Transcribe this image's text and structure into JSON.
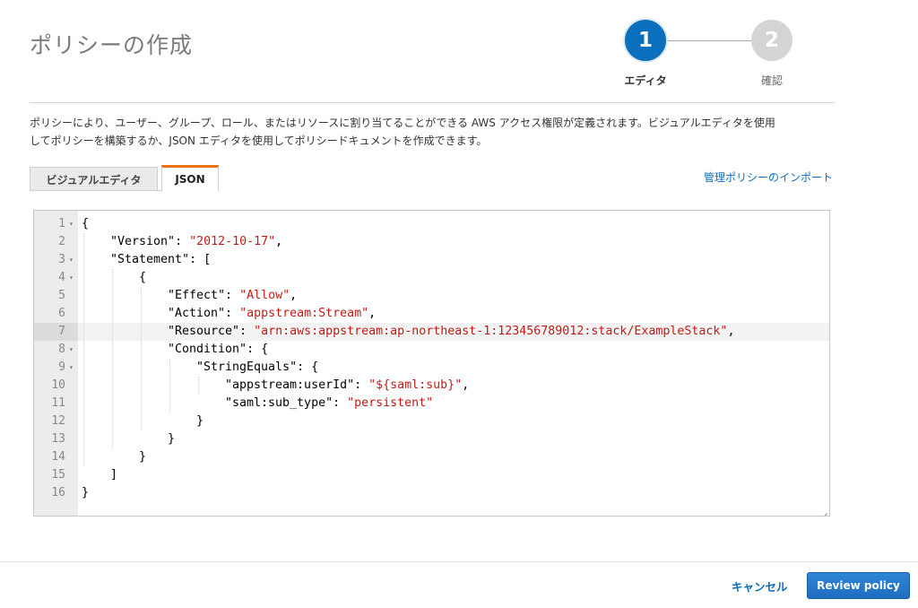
{
  "page": {
    "title": "ポリシーの作成"
  },
  "stepper": {
    "steps": [
      {
        "number": "1",
        "label": "エディタ",
        "state": "active"
      },
      {
        "number": "2",
        "label": "確認",
        "state": "inactive"
      }
    ],
    "active_color": "#0a6fbc",
    "inactive_color": "#d4d4d4"
  },
  "description": {
    "line1": "ポリシーにより、ユーザー、グループ、ロール、またはリソースに割り当てることができる AWS アクセス権限が定義されます。ビジュアルエディタを使用",
    "line2": "してポリシーを構築するか、JSON エディタを使用してポリシードキュメントを作成できます。"
  },
  "tabs": [
    {
      "label": "ビジュアルエディタ",
      "selected": false
    },
    {
      "label": "JSON",
      "selected": true
    }
  ],
  "import_link": "管理ポリシーのインポート",
  "editor": {
    "active_line": 7,
    "lines": [
      {
        "n": "1",
        "fold": true,
        "indent": 0,
        "parts": [
          [
            "p",
            "{"
          ]
        ]
      },
      {
        "n": "2",
        "fold": false,
        "indent": 1,
        "parts": [
          [
            "k",
            "\"Version\""
          ],
          [
            "p",
            ": "
          ],
          [
            "s",
            "\"2012-10-17\""
          ],
          [
            "p",
            ","
          ]
        ]
      },
      {
        "n": "3",
        "fold": true,
        "indent": 1,
        "parts": [
          [
            "k",
            "\"Statement\""
          ],
          [
            "p",
            ": ["
          ]
        ]
      },
      {
        "n": "4",
        "fold": true,
        "indent": 2,
        "parts": [
          [
            "p",
            "{"
          ]
        ]
      },
      {
        "n": "5",
        "fold": false,
        "indent": 3,
        "parts": [
          [
            "k",
            "\"Effect\""
          ],
          [
            "p",
            ": "
          ],
          [
            "s",
            "\"Allow\""
          ],
          [
            "p",
            ","
          ]
        ]
      },
      {
        "n": "6",
        "fold": false,
        "indent": 3,
        "parts": [
          [
            "k",
            "\"Action\""
          ],
          [
            "p",
            ": "
          ],
          [
            "s",
            "\"appstream:Stream\""
          ],
          [
            "p",
            ","
          ]
        ]
      },
      {
        "n": "7",
        "fold": false,
        "indent": 3,
        "parts": [
          [
            "k",
            "\"Resource\""
          ],
          [
            "p",
            ": "
          ],
          [
            "s",
            "\"arn:aws:appstream:ap-northeast-1:123456789012:stack/ExampleStack\""
          ],
          [
            "p",
            ","
          ]
        ]
      },
      {
        "n": "8",
        "fold": true,
        "indent": 3,
        "parts": [
          [
            "k",
            "\"Condition\""
          ],
          [
            "p",
            ": {"
          ]
        ]
      },
      {
        "n": "9",
        "fold": true,
        "indent": 4,
        "parts": [
          [
            "k",
            "\"StringEquals\""
          ],
          [
            "p",
            ": {"
          ]
        ]
      },
      {
        "n": "10",
        "fold": false,
        "indent": 5,
        "parts": [
          [
            "k",
            "\"appstream:userId\""
          ],
          [
            "p",
            ": "
          ],
          [
            "s",
            "\"${saml:sub}\""
          ],
          [
            "p",
            ","
          ]
        ]
      },
      {
        "n": "11",
        "fold": false,
        "indent": 5,
        "parts": [
          [
            "k",
            "\"saml:sub_type\""
          ],
          [
            "p",
            ": "
          ],
          [
            "s",
            "\"persistent\""
          ]
        ]
      },
      {
        "n": "12",
        "fold": false,
        "indent": 4,
        "parts": [
          [
            "p",
            "}"
          ]
        ]
      },
      {
        "n": "13",
        "fold": false,
        "indent": 3,
        "parts": [
          [
            "p",
            "}"
          ]
        ]
      },
      {
        "n": "14",
        "fold": false,
        "indent": 2,
        "parts": [
          [
            "p",
            "}"
          ]
        ]
      },
      {
        "n": "15",
        "fold": false,
        "indent": 1,
        "parts": [
          [
            "p",
            "]"
          ]
        ]
      },
      {
        "n": "16",
        "fold": false,
        "indent": 0,
        "parts": [
          [
            "p",
            "}"
          ]
        ]
      }
    ],
    "string_color": "#c41a16"
  },
  "footer": {
    "cancel_label": "キャンセル",
    "review_label": "Review policy"
  }
}
